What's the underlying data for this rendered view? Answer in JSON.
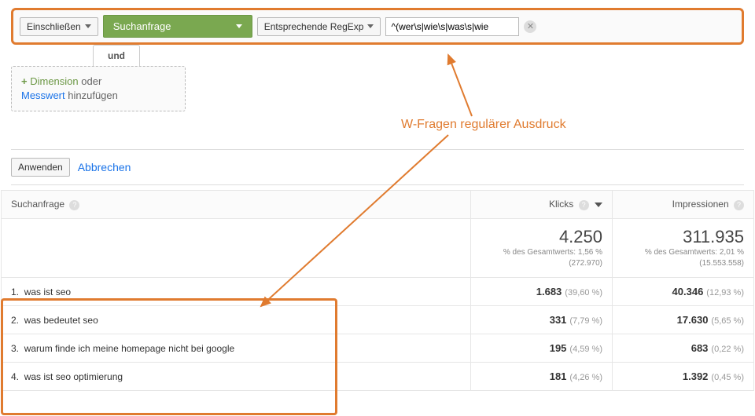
{
  "colors": {
    "accent": "#e07b2f",
    "green": "#7aa850",
    "link": "#1a73e8"
  },
  "filter": {
    "include_label": "Einschließen",
    "dimension_label": "Suchanfrage",
    "match_label": "Entsprechende RegExp",
    "regex_value": "^(wer\\s|wie\\s|was\\s|wie",
    "clear_tooltip": "Löschen"
  },
  "tabs": {
    "und": "und"
  },
  "add_dimension": {
    "plus": "+",
    "dim_word": "Dimension",
    "oder": "oder",
    "mess_word": "Messwert",
    "hinzu": "hinzufügen"
  },
  "annotation": "W-Fragen regulärer Ausdruck",
  "apply": {
    "apply_label": "Anwenden",
    "cancel_label": "Abbrechen"
  },
  "table": {
    "headers": {
      "query": "Suchanfrage",
      "clicks": "Klicks",
      "impressions": "Impressionen"
    },
    "totals": {
      "clicks": {
        "value": "4.250",
        "pct_line": "% des Gesamtwerts: 1,56 %",
        "base": "(272.970)"
      },
      "impressions": {
        "value": "311.935",
        "pct_line": "% des Gesamtwerts: 2,01 %",
        "base": "(15.553.558)"
      }
    },
    "rows": [
      {
        "n": "1.",
        "query": "was ist seo",
        "clicks": "1.683",
        "clicks_pct": "(39,60 %)",
        "impr": "40.346",
        "impr_pct": "(12,93 %)"
      },
      {
        "n": "2.",
        "query": "was bedeutet seo",
        "clicks": "331",
        "clicks_pct": "(7,79 %)",
        "impr": "17.630",
        "impr_pct": "(5,65 %)"
      },
      {
        "n": "3.",
        "query": "warum finde ich meine homepage nicht bei google",
        "clicks": "195",
        "clicks_pct": "(4,59 %)",
        "impr": "683",
        "impr_pct": "(0,22 %)"
      },
      {
        "n": "4.",
        "query": "was ist seo optimierung",
        "clicks": "181",
        "clicks_pct": "(4,26 %)",
        "impr": "1.392",
        "impr_pct": "(0,45 %)"
      }
    ]
  }
}
